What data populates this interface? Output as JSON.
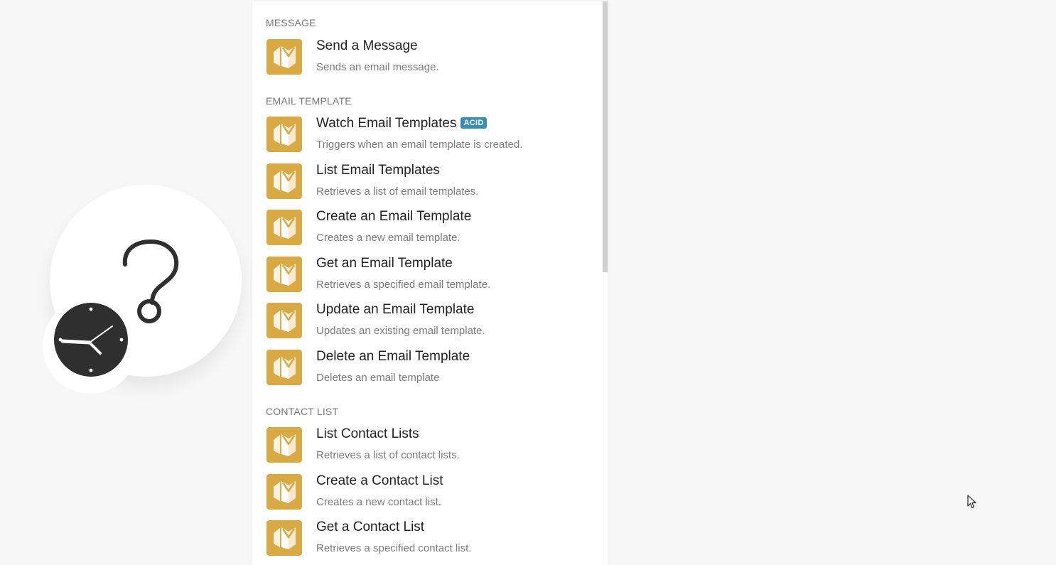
{
  "colors": {
    "app_icon_bg": "#d9a944",
    "badge_bg": "#3a8cb8",
    "canvas_bg": "#f7f7f7"
  },
  "module": {
    "icon": "question-mark-icon",
    "trigger_icon": "clock-icon"
  },
  "sections": {
    "message": {
      "title": "MESSAGE",
      "items": [
        {
          "title": "Send a Message",
          "description": "Sends an email message."
        }
      ]
    },
    "email_template": {
      "title": "EMAIL TEMPLATE",
      "items": [
        {
          "title": "Watch Email Templates",
          "badge": "ACID",
          "description": "Triggers when an email template is created."
        },
        {
          "title": "List Email Templates",
          "description": "Retrieves a list of email templates."
        },
        {
          "title": "Create an Email Template",
          "description": "Creates a new email template."
        },
        {
          "title": "Get an Email Template",
          "description": "Retrieves a specified email template."
        },
        {
          "title": "Update an Email Template",
          "description": "Updates an existing email template."
        },
        {
          "title": "Delete an Email Template",
          "description": "Deletes an email template"
        }
      ]
    },
    "contact_list": {
      "title": "CONTACT LIST",
      "items": [
        {
          "title": "List Contact Lists",
          "description": "Retrieves a list of contact lists."
        },
        {
          "title": "Create a Contact List",
          "description": "Creates a new contact list."
        },
        {
          "title": "Get a Contact List",
          "description": "Retrieves a specified contact list."
        }
      ]
    }
  }
}
